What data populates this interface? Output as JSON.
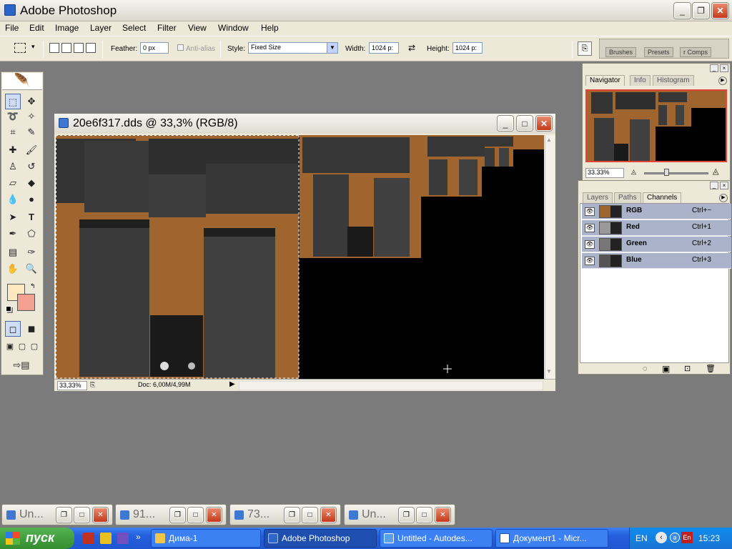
{
  "app": {
    "title": "Adobe Photoshop"
  },
  "menu": [
    "File",
    "Edit",
    "Image",
    "Layer",
    "Select",
    "Filter",
    "View",
    "Window",
    "Help"
  ],
  "options": {
    "feather_label": "Feather:",
    "feather_value": "0 px",
    "antialias_label": "Anti-alias",
    "style_label": "Style:",
    "style_value": "Fixed Size",
    "width_label": "Width:",
    "width_value": "1024 p:",
    "height_label": "Height:",
    "height_value": "1024 p:"
  },
  "palette_well": [
    "Brushes",
    "Presets",
    "r Comps"
  ],
  "document": {
    "title": "20e6f317.dds @ 33,3% (RGB/8)",
    "zoom": "33,33%",
    "doc_info": "Doc: 6,00M/4,99M"
  },
  "navigator": {
    "tabs": [
      "Navigator",
      "Info",
      "Histogram"
    ],
    "zoom": "33.33%"
  },
  "channels_panel": {
    "tabs": [
      "Layers",
      "Paths",
      "Channels"
    ],
    "channels": [
      {
        "name": "RGB",
        "shortcut": "Ctrl+~"
      },
      {
        "name": "Red",
        "shortcut": "Ctrl+1"
      },
      {
        "name": "Green",
        "shortcut": "Ctrl+2"
      },
      {
        "name": "Blue",
        "shortcut": "Ctrl+3"
      }
    ]
  },
  "minimized": [
    {
      "title": "Un..."
    },
    {
      "title": "91..."
    },
    {
      "title": "73..."
    },
    {
      "title": "Un..."
    }
  ],
  "taskbar": {
    "start": "пуск",
    "buttons": [
      {
        "label": "Дима-1"
      },
      {
        "label": "Adobe Photoshop"
      },
      {
        "label": "Untitled - Autodes..."
      },
      {
        "label": "Документ1 - Micr..."
      }
    ],
    "lang": "EN",
    "lang2": "En",
    "time": "15:23"
  },
  "colors": {
    "foreground": "#fde8c0",
    "background": "#f4a090",
    "fabric": "#3a3a3a",
    "skin": "#a0642e"
  }
}
